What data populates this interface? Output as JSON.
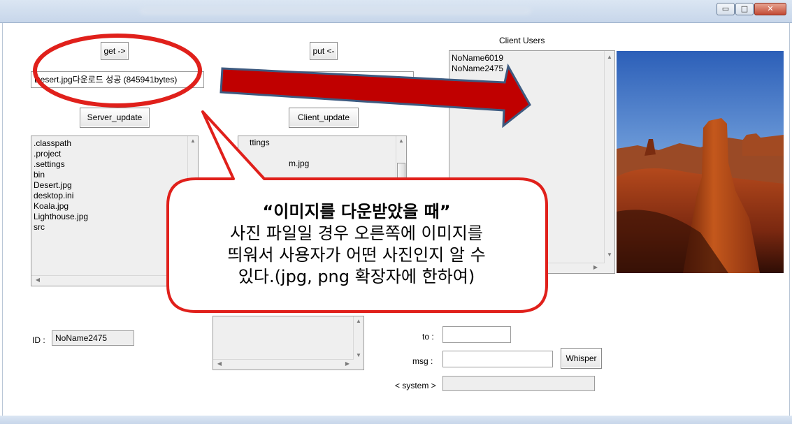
{
  "window": {
    "minimize": "▭",
    "maximize": "□",
    "close": "✕"
  },
  "toolbar": {
    "get_label": "get ->",
    "put_label": "put <-",
    "server_update_label": "Server_update",
    "client_update_label": "Client_update"
  },
  "status_field": {
    "value": "Desert.jpg다운로드 성공 (845941bytes)"
  },
  "client_path_field": {
    "value": ""
  },
  "server_files": [
    ".classpath",
    ".project",
    ".settings",
    "bin",
    "Desert.jpg",
    "desktop.ini",
    "Koala.jpg",
    "Lighthouse.jpg",
    "src"
  ],
  "client_files": {
    "partial_1": "ttings",
    "partial_2": "m.jpg"
  },
  "client_users": {
    "title": "Client Users",
    "users": [
      "NoName6019",
      "NoName2475"
    ]
  },
  "preview_image": {
    "subject": "desert-butte-photo"
  },
  "bottom": {
    "id_label": "ID :",
    "id_value": "NoName2475",
    "to_label": "to :",
    "to_value": "",
    "msg_label": "msg :",
    "msg_value": "",
    "whisper_label": "Whisper",
    "system_label": "< system >",
    "system_value": ""
  },
  "annotation": {
    "headline": "“이미지를 다운받았을 때”",
    "line1": "사진 파일일 경우 오른쪽에 이미지를",
    "line2": "띄워서 사용자가 어떤 사진인지 알 수",
    "line3": "있다.(jpg, png 확장자에 한하여)"
  },
  "colors": {
    "annotation_red": "#e0201b",
    "arrow_fill": "#c00000",
    "arrow_outline": "#3d5a80"
  }
}
